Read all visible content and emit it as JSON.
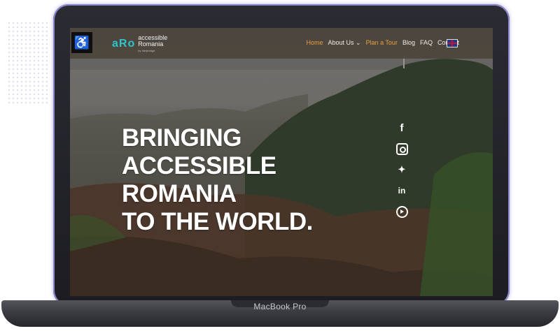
{
  "device": {
    "label": "MacBook Pro"
  },
  "nav": {
    "accessibility_icon": "wheelchair-icon",
    "logo": {
      "mark": "aRo",
      "line1": "accessible",
      "line2": "Romania",
      "line3": "by Ideabridge"
    },
    "items": [
      {
        "label": "Home",
        "state": "active"
      },
      {
        "label": "About Us ⌄",
        "state": "normal"
      },
      {
        "label": "Plan a Tour",
        "state": "highlight"
      },
      {
        "label": "Blog",
        "state": "normal"
      },
      {
        "label": "FAQ",
        "state": "normal"
      },
      {
        "label": "Contact",
        "state": "normal"
      }
    ],
    "language_flag": "uk-flag-icon"
  },
  "hero": {
    "line1": "BRINGING",
    "line2": "ACCESSIBLE ROMANIA",
    "line3": "TO THE WORLD."
  },
  "social": [
    {
      "name": "facebook-icon",
      "glyph": "f"
    },
    {
      "name": "instagram-icon",
      "glyph": ""
    },
    {
      "name": "twitter-icon",
      "glyph": "🐦"
    },
    {
      "name": "linkedin-icon",
      "glyph": "in"
    },
    {
      "name": "youtube-icon",
      "glyph": ""
    }
  ],
  "colors": {
    "accent": "#e7a040",
    "logo": "#2ec4c9",
    "nav_bg": "#4b443c"
  }
}
